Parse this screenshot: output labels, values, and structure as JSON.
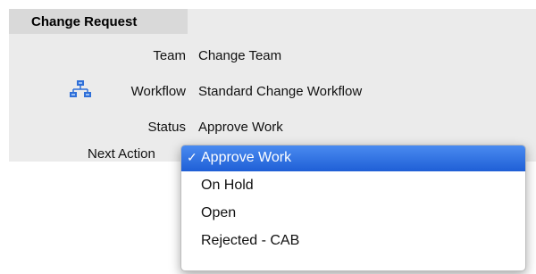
{
  "section": {
    "title": "Change Request"
  },
  "fields": {
    "team": {
      "label": "Team",
      "value": "Change Team"
    },
    "workflow": {
      "label": "Workflow",
      "value": "Standard Change Workflow"
    },
    "status": {
      "label": "Status",
      "value": "Approve Work"
    },
    "next_action": {
      "label": "Next Action"
    }
  },
  "dropdown": {
    "check_glyph": "✓",
    "options": [
      "Approve Work",
      "On Hold",
      "Open",
      "Rejected - CAB"
    ],
    "selected": "Approve Work"
  },
  "icons": {
    "workflow": "workflow-hierarchy-icon"
  },
  "colors": {
    "selection": "#2f6fe0",
    "panel": "#ebebeb",
    "header": "#d9d9d9",
    "icon": "#2f6fd8"
  }
}
